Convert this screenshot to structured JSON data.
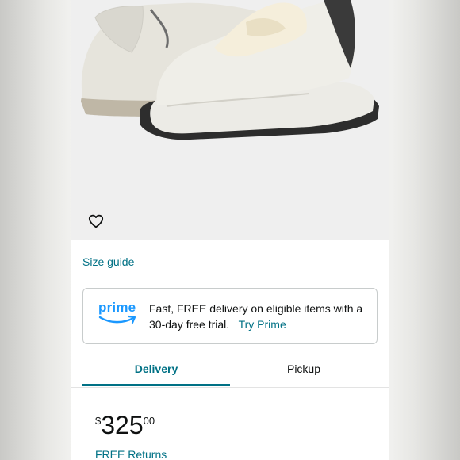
{
  "product": {
    "image_alt": "White leather sneaker with cream ribbon laces",
    "favorite_icon": "heart-outline-icon"
  },
  "size_guide": {
    "label": "Size guide"
  },
  "prime_banner": {
    "logo_text": "prime",
    "message": "Fast, FREE delivery on eligible items with a 30-day free trial.",
    "link_label": "Try Prime"
  },
  "tabs": [
    {
      "label": "Delivery",
      "selected": true
    },
    {
      "label": "Pickup",
      "selected": false
    }
  ],
  "price": {
    "symbol": "$",
    "whole": "325",
    "fraction": "00"
  },
  "returns": {
    "label": "FREE Returns"
  },
  "colors": {
    "link": "#007185",
    "prime_blue": "#1a98ff",
    "text": "#0f1111"
  }
}
